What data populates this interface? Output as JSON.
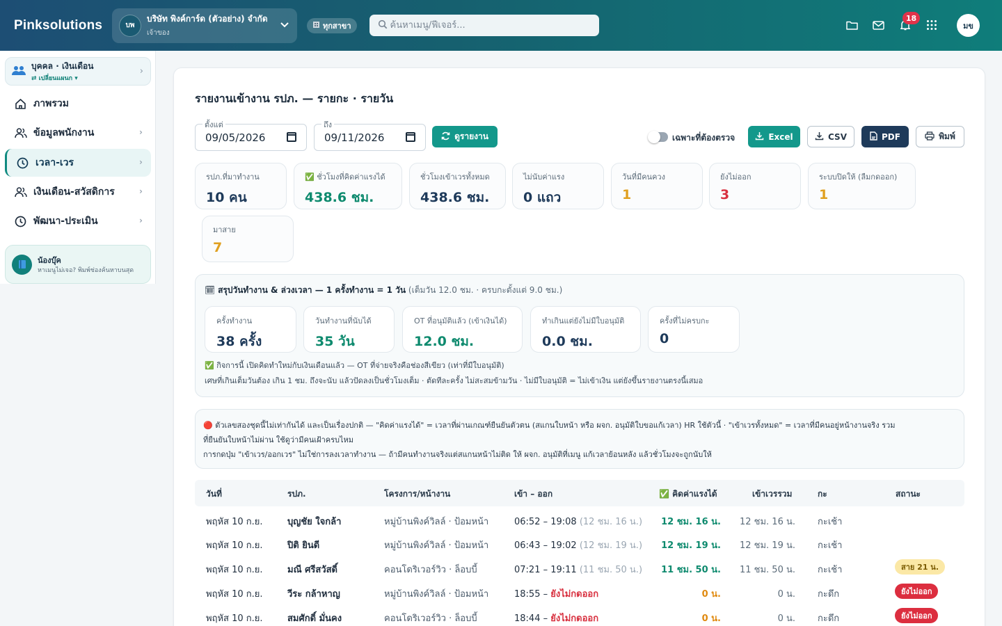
{
  "topbar": {
    "brand": "Pinksolutions",
    "company_initials": "บพ",
    "company_name": "บริษัท พิงค์การ์ด (ตัวอย่าง) จำกัด",
    "company_role": "เจ้าของ",
    "branch_label": "ทุกสาขา",
    "search_placeholder": "ค้นหาเมนู/ฟีเจอร์...",
    "notification_count": "18",
    "user_initials": "มข"
  },
  "sidebar": {
    "switcher_title": "บุคคล · เงินเดือน",
    "switcher_sub": "⇄ เปลี่ยนแผนก ▾",
    "items": [
      {
        "label": "ภาพรวม",
        "icon": "home-icon"
      },
      {
        "label": "ข้อมูลพนักงาน",
        "icon": "users-icon"
      },
      {
        "label": "เวลา-เวร",
        "icon": "clock-icon"
      },
      {
        "label": "เงินเดือน-สวัสดิการ",
        "icon": "users-icon"
      },
      {
        "label": "พัฒนา-ประเมิน",
        "icon": "clock-icon"
      }
    ],
    "help_title": "น้องบุ๊ค",
    "help_sub": "หาเมนูไม่เจอ? พิมพ์ช่องค้นหาบนสุด"
  },
  "report": {
    "title": "รายงานเข้างาน รปภ. — รายกะ · รายวัน",
    "from_label": "ตั้งแต่",
    "from_value": "09/05/2026",
    "to_label": "ถึง",
    "to_value": "09/11/2026",
    "view_button": "ดูรายงาน",
    "toggle_label": "เฉพาะที่ต้องตรวจ",
    "excel_button": "Excel",
    "csv_button": "CSV",
    "pdf_button": "PDF",
    "print_button": "พิมพ์"
  },
  "stats": [
    {
      "label": "รปภ.ที่มาทำงาน",
      "value": "10 คน",
      "color": "#1e3a5a"
    },
    {
      "label": "✅ ชั่วโมงที่คิดค่าแรงได้",
      "value": "438.6 ชม.",
      "color": "#0e8a6e"
    },
    {
      "label": "ชั่วโมงเข้าเวรทั้งหมด",
      "value": "438.6 ชม.",
      "color": "#1e3a5a"
    },
    {
      "label": "ไม่นับค่าแรง",
      "value": "0 แถว",
      "color": "#1e3a5a"
    },
    {
      "label": "วันที่มีคนควง",
      "value": "1",
      "color": "#e0a020"
    },
    {
      "label": "ยังไม่ออก",
      "value": "3",
      "color": "#d8303f"
    },
    {
      "label": "ระบบปิดให้ (ลืมกดออก)",
      "value": "1",
      "color": "#e0a020"
    },
    {
      "label": "มาสาย",
      "value": "7",
      "color": "#e0a020"
    }
  ],
  "summary": {
    "title": "สรุปวันทำงาน & ล่วงเวลา — 1 ครั้งทำงาน = 1 วัน",
    "title_note": "(เต็มวัน 12.0 ชม. · ครบกะตั้งแต่ 9.0 ชม.)",
    "stats": [
      {
        "label": "ครั้งทำงาน",
        "value": "38 ครั้ง",
        "color": "#1e3a5a"
      },
      {
        "label": "วันทำงานที่นับได้",
        "value": "35 วัน",
        "color": "#0e8a6e"
      },
      {
        "label": "OT ที่อนุมัติแล้ว (เข้าเงินได้)",
        "value": "12.0 ชม.",
        "color": "#0e8a6e"
      },
      {
        "label": "ทำเกินแต่ยังไม่มีใบอนุมัติ",
        "value": "0.0 ชม.",
        "color": "#1e3a5a"
      },
      {
        "label": "ครั้งที่ไม่ครบกะ",
        "value": "0",
        "color": "#1e3a5a"
      }
    ],
    "note1": "✅ กิจการนี้ เปิดคิดทำใหม่กับเงินเดือนแล้ว — OT ที่จ่ายจริงคือช่องสีเขียว (เท่าที่มีใบอนุมัติ)",
    "note2": "เศษที่เกินเต็มวันต้อง เกิน 1 ชม. ถึงจะนับ แล้วปัดลงเป็นชั่วโมงเต็ม · ตัดทีละครั้ง ไม่สะสมข้ามวัน · ไม่มีใบอนุมัติ = ไม่เข้าเงิน แต่ยังขึ้นรายงานตรงนี้เสมอ"
  },
  "warning": {
    "line1": "🔴 ตัวเลขสองชุดนี้ไม่เท่ากันได้ และเป็นเรื่องปกติ — \"คิดค่าแรงได้\" = เวลาที่ผ่านเกณฑ์ยืนยันตัวตน (สแกนใบหน้า หรือ ผจก. อนุมัติใบขอแก้เวลา) HR ใช้ตัวนี้ · \"เข้าเวรทั้งหมด\" = เวลาที่มีคนอยู่หน้างานจริง รวม",
    "line2": "ที่ยืนยันใบหน้าไม่ผ่าน ใช้ดูว่ามีคนเฝ้าครบไหม",
    "line3": "การกดปุ่ม \"เข้าเวร/ออกเวร\" ไม่ใช่การลงเวลาทำงาน — ถ้ามีคนทำงานจริงแต่สแกนหน้าไม่ติด ให้ ผจก. อนุมัติที่เมนู แก้เวลาย้อนหลัง แล้วชั่วโมงจะถูกนับให้"
  },
  "table": {
    "headers": [
      "วันที่",
      "รปภ.",
      "โครงการ/หน้างาน",
      "เข้า – ออก",
      "✅ คิดค่าแรงได้",
      "เข้าเวรรวม",
      "กะ",
      "สถานะ"
    ],
    "rows": [
      {
        "date": "พฤหัส 10 ก.ย.",
        "guard": "บุญชัย ใจกล้า",
        "site": "หมู่บ้านพิงค์วิลล์ · ป้อมหน้า",
        "inout": "06:52 – 19:08",
        "dur": "(12 ชม. 16 น.)",
        "paid": "12 ชม. 16 น.",
        "total": "12 ชม. 16 น.",
        "shift": "กะเช้า",
        "status": ""
      },
      {
        "date": "พฤหัส 10 ก.ย.",
        "guard": "ปิติ ยินดี",
        "site": "หมู่บ้านพิงค์วิลล์ · ป้อมหน้า",
        "inout": "06:43 – 19:02",
        "dur": "(12 ชม. 19 น.)",
        "paid": "12 ชม. 19 น.",
        "total": "12 ชม. 19 น.",
        "shift": "กะเช้า",
        "status": ""
      },
      {
        "date": "พฤหัส 10 ก.ย.",
        "guard": "มณี ศรีสวัสดิ์",
        "site": "คอนโดริเวอร์วิว · ล็อบบี้",
        "inout": "07:21 – 19:11",
        "dur": "(11 ชม. 50 น.)",
        "paid": "11 ชม. 50 น.",
        "total": "11 ชม. 50 น.",
        "shift": "กะเช้า",
        "status": "สาย 21 น."
      },
      {
        "date": "พฤหัส 10 ก.ย.",
        "guard": "วีระ กล้าหาญ",
        "site": "หมู่บ้านพิงค์วิลล์ · ป้อมหน้า",
        "inout": "18:55 – ",
        "out_missing": "ยังไม่กดออก",
        "paid": "0 น.",
        "total": "0 น.",
        "shift": "กะดึก",
        "status": "ยังไม่ออก"
      },
      {
        "date": "พฤหัส 10 ก.ย.",
        "guard": "สมศักดิ์ มั่นคง",
        "site": "คอนโดริเวอร์วิว · ล็อบบี้",
        "inout": "18:44 – ",
        "out_missing": "ยังไม่กดออก",
        "paid": "0 น.",
        "total": "0 น.",
        "shift": "กะดึก",
        "status": "ยังไม่ออก"
      }
    ]
  }
}
